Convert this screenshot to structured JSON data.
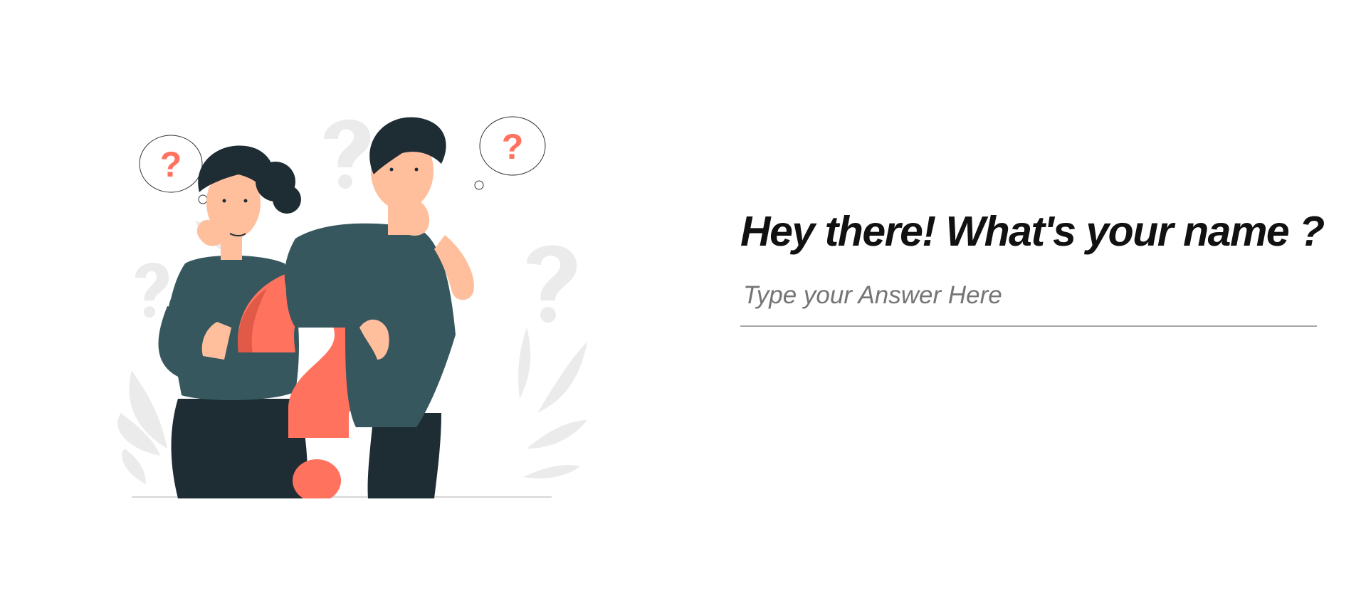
{
  "question": {
    "title": "Hey there! What's your name ?"
  },
  "answer": {
    "value": "",
    "placeholder": "Type your Answer Here"
  },
  "illustration": {
    "icons": [
      "thinking-woman",
      "thinking-man",
      "question-mark-icon",
      "thought-bubble-icon",
      "leaf-decoration"
    ],
    "colors": {
      "accent": "#ff725e",
      "shirt": "#37575f",
      "pants": "#1e2d33",
      "skin": "#ffbf9d",
      "hair": "#1e2d33",
      "decoration": "#ebebeb"
    }
  }
}
